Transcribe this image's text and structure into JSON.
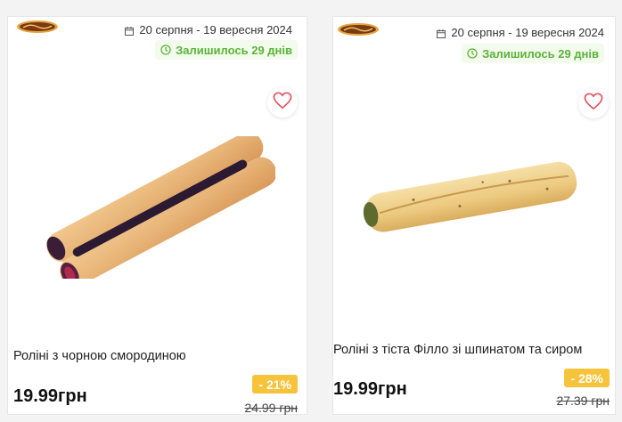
{
  "colors": {
    "accent_green": "#5bb33a",
    "discount_yellow": "#f6c33b",
    "heart_red": "#e05060",
    "logo_brown": "#7a3a12"
  },
  "products": [
    {
      "brand_logo": "Сільпо",
      "date_icon": "calendar-icon",
      "date_range": "20 серпня - 19 вересня 2024",
      "remaining_icon": "clock-icon",
      "remaining": "Залишилось 29 днів",
      "favorite_icon": "heart-icon",
      "title": "Роліні з чорною смородиною",
      "price": "19.99грн",
      "discount": "- 21%",
      "old_price": "24.99 грн"
    },
    {
      "brand_logo": "Сільпо",
      "date_icon": "calendar-icon",
      "date_range": "20 серпня - 19 вересня 2024",
      "remaining_icon": "clock-icon",
      "remaining": "Залишилось 29 днів",
      "favorite_icon": "heart-icon",
      "title": "Роліні з тіста Філло зі шпинатом та сиром",
      "price": "19.99грн",
      "discount": "- 28%",
      "old_price": "27.39 грн"
    }
  ]
}
